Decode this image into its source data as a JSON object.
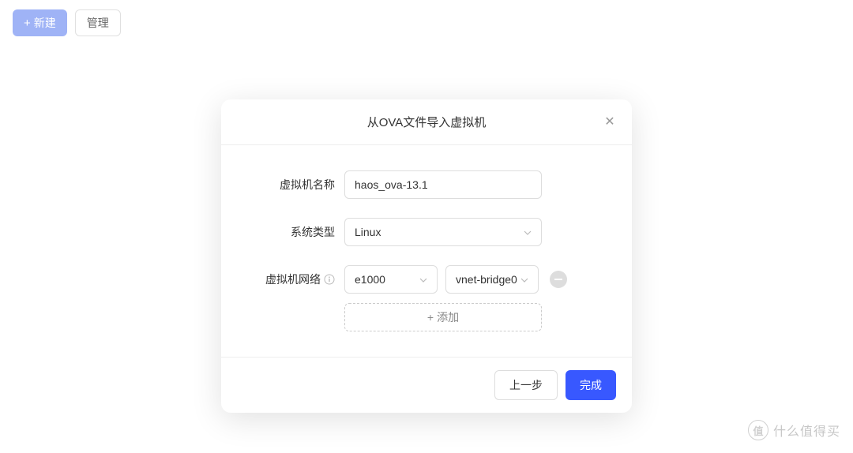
{
  "toolbar": {
    "new_label": "新建",
    "manage_label": "管理"
  },
  "modal": {
    "title": "从OVA文件导入虚拟机",
    "labels": {
      "vm_name": "虚拟机名称",
      "os_type": "系统类型",
      "vm_network": "虚拟机网络"
    },
    "values": {
      "vm_name": "haos_ova-13.1",
      "os_type": "Linux",
      "network_type": "e1000",
      "network_bridge": "vnet-bridge0"
    },
    "add_label": "添加",
    "footer": {
      "prev": "上一步",
      "finish": "完成"
    }
  },
  "watermark": {
    "icon_text": "值",
    "text": "什么值得买"
  }
}
